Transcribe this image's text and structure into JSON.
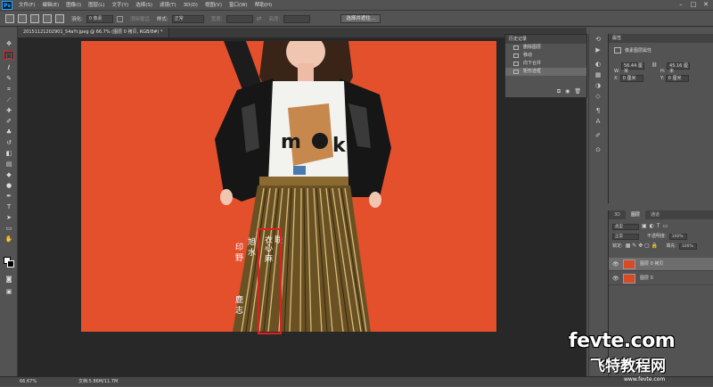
{
  "app": {
    "logo": "Ps"
  },
  "menu": [
    "文件(F)",
    "编辑(E)",
    "图像(I)",
    "图层(L)",
    "文字(Y)",
    "选择(S)",
    "滤镜(T)",
    "3D(D)",
    "视图(V)",
    "窗口(W)",
    "帮助(H)"
  ],
  "options": {
    "feather_label": "羽化:",
    "feather_value": "0 像素",
    "antialias_label": "消除锯齿",
    "style_label": "样式:",
    "style_value": "正常",
    "width_label": "宽度:",
    "height_label": "高度:",
    "refine_button": "选择并遮住..."
  },
  "document": {
    "tab_title": "20151121202901_54aYr.jpeg @ 66.7% (图层 0 拷贝, RGB/8#) *"
  },
  "canvas_text": {
    "line1": "衣心 麻",
    "line2": "联",
    "line3": "旭 水",
    "line4": "印 野",
    "line5": "鹿 志"
  },
  "history": {
    "title": "历史记录",
    "items": [
      "删除图层",
      "移动",
      "向下合并",
      "矩形选框"
    ],
    "selected_index": 3
  },
  "properties": {
    "title": "属性",
    "type": "像素图层属性",
    "w_label": "W:",
    "w_value": "56.44 厘米",
    "h_label": "H:",
    "h_value": "45.16 厘米",
    "x_label": "X:",
    "x_value": "0 厘米",
    "y_label": "Y:",
    "y_value": "0 厘米"
  },
  "layers": {
    "tabs": [
      "3D",
      "图层",
      "通道"
    ],
    "active_tab": 1,
    "kind_label": "类型",
    "blend_mode": "正常",
    "opacity_label": "不透明度:",
    "opacity_value": "100%",
    "lock_label": "锁定:",
    "fill_label": "填充:",
    "fill_value": "100%",
    "items": [
      "图层 0 拷贝",
      "图层 0"
    ]
  },
  "status": {
    "zoom": "66.67%",
    "doc_info": "文档:5.86M/11.7M"
  },
  "watermark": {
    "line1": "fevte.com",
    "line2": "飞特教程网",
    "line3": "www.fevte.com"
  },
  "colors": {
    "canvas_bg": "#e4502c",
    "accent_red": "#e02020"
  }
}
